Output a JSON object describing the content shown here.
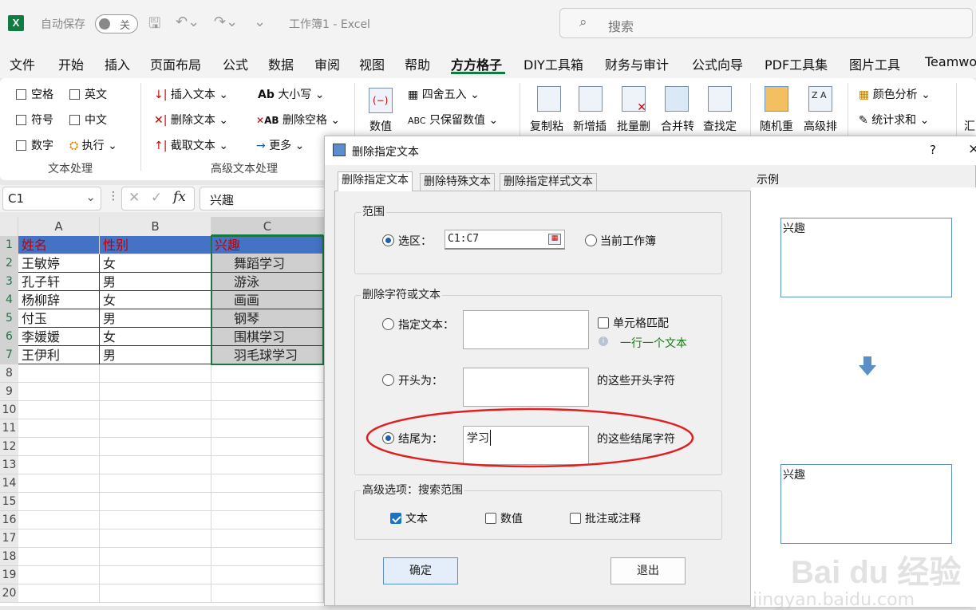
{
  "titlebar": {
    "logo": "X",
    "autosave_label": "自动保存",
    "autosave_state": "关",
    "workbook_title": "工作簿1  -  Excel",
    "search_placeholder": "搜索"
  },
  "menu": [
    "文件",
    "开始",
    "插入",
    "页面布局",
    "公式",
    "数据",
    "审阅",
    "视图",
    "帮助",
    "方方格子",
    "DIY工具箱",
    "财务与审计",
    "公式向导",
    "PDF工具集",
    "图片工具",
    "Teamwo"
  ],
  "active_menu": "方方格子",
  "ribbon": {
    "text_group": {
      "items": [
        "空格",
        "英文",
        "符号",
        "中文",
        "数字",
        "执行"
      ],
      "label": "文本处理"
    },
    "adv_group": {
      "items": [
        "插入文本",
        "删除文本",
        "截取文本",
        "大小写",
        "删除空格",
        "更多"
      ],
      "label": "高级文本处理"
    },
    "value_group": {
      "big": "数值",
      "items": [
        "四舍五入",
        "只保留数值"
      ]
    },
    "big_buttons": [
      "复制粘",
      "新增插",
      "批量删",
      "合并转",
      "查找定",
      "随机重",
      "高级排"
    ],
    "right_items": [
      "颜色分析",
      "统计求和"
    ],
    "last": "汇"
  },
  "formula_bar": {
    "name_box": "C1",
    "fx": "fx",
    "value": "兴趣"
  },
  "sheet": {
    "columns": [
      "A",
      "B",
      "C"
    ],
    "rows": [
      [
        "姓名",
        "性别",
        "兴趣"
      ],
      [
        "王敏婷",
        "女",
        "舞蹈学习"
      ],
      [
        "孔子轩",
        "男",
        "游泳"
      ],
      [
        "杨柳辞",
        "女",
        "画画"
      ],
      [
        "付玉",
        "男",
        "钢琴"
      ],
      [
        "李媛媛",
        "女",
        "围棋学习"
      ],
      [
        "王伊利",
        "男",
        "羽毛球学习"
      ]
    ],
    "row_numbers": [
      "1",
      "2",
      "3",
      "4",
      "5",
      "6",
      "7",
      "8",
      "9",
      "10",
      "11",
      "12",
      "13",
      "14",
      "15",
      "16",
      "17",
      "18",
      "19",
      "20"
    ]
  },
  "dialog": {
    "title": "删除指定文本",
    "help": "?",
    "close": "×",
    "tabs": [
      "删除指定文本",
      "删除特殊文本",
      "删除指定样式文本"
    ],
    "range_group": {
      "title": "范围",
      "selection_label": "选区：",
      "selection_value": "C1:C7",
      "workbook_label": "当前工作簿"
    },
    "delete_group": {
      "title": "删除字符或文本",
      "specified_label": "指定文本：",
      "cell_match_label": "单元格匹配",
      "hint": "一行一个文本",
      "starts_label": "开头为：",
      "starts_suffix": "的这些开头字符",
      "ends_label": "结尾为：",
      "ends_value": "学习",
      "ends_suffix": "的这些结尾字符"
    },
    "advanced_group": {
      "title": "高级选项：搜索范围",
      "options": [
        "文本",
        "数值",
        "批注或注释"
      ],
      "checked": [
        true,
        false,
        false
      ]
    },
    "ok": "确定",
    "exit": "退出",
    "preview_label": "示例",
    "preview_before": "兴趣",
    "preview_after": "兴趣"
  },
  "watermark": {
    "brand": "Bai du 经验",
    "url": "jingyan.baidu.com"
  },
  "colors": {
    "header_blue": "#4472c4",
    "header_red_text": "#c00000",
    "annotation_red": "#e02020",
    "excel_green": "#107c41"
  }
}
